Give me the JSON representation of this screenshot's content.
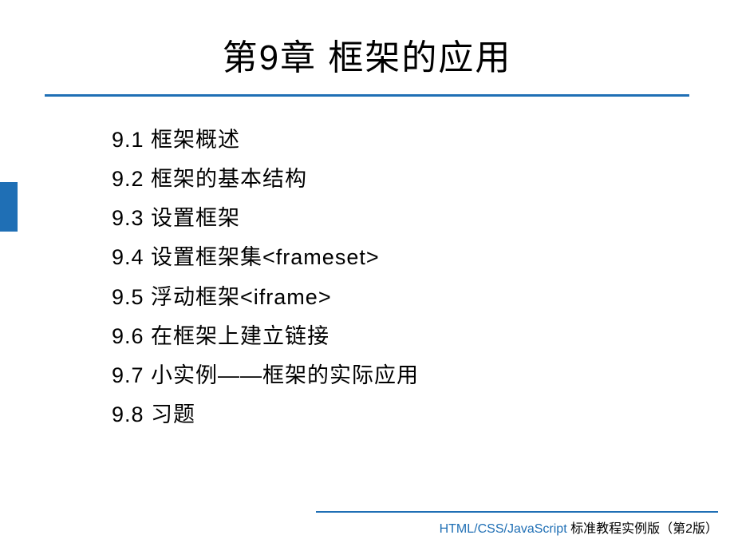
{
  "title": "第9章  框架的应用",
  "toc": [
    "9.1  框架概述",
    "9.2  框架的基本结构",
    "9.3  设置框架",
    "9.4  设置框架集<frameset>",
    "9.5  浮动框架<iframe>",
    "9.6  在框架上建立链接",
    "9.7  小实例——框架的实际应用",
    "9.8  习题"
  ],
  "footer": {
    "brand": "HTML/CSS/JavaScript",
    "tail": " 标准教程实例版（第2版）"
  },
  "colors": {
    "accent": "#1f6fb5"
  }
}
